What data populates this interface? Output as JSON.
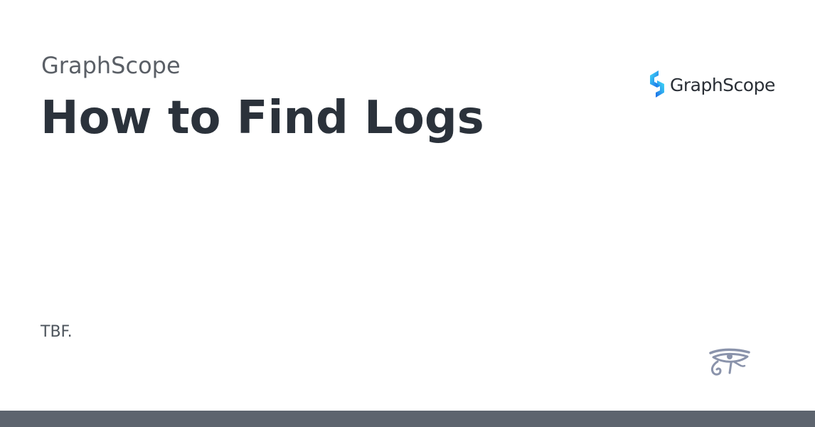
{
  "site": {
    "name": "GraphScope"
  },
  "page": {
    "title": "How to Find Logs",
    "description": "TBF."
  },
  "logo": {
    "text": "GraphScope",
    "icon": "graphscope-logo-icon"
  },
  "decoration": {
    "icon": "eye-of-horus-icon"
  },
  "colors": {
    "title": "#2b323b",
    "subtitle": "#5a5f66",
    "footer_bar": "#5d646e",
    "logo_accent_start": "#3dd6f5",
    "logo_accent_end": "#1f6fe8",
    "eye_icon": "#8a93ab"
  }
}
